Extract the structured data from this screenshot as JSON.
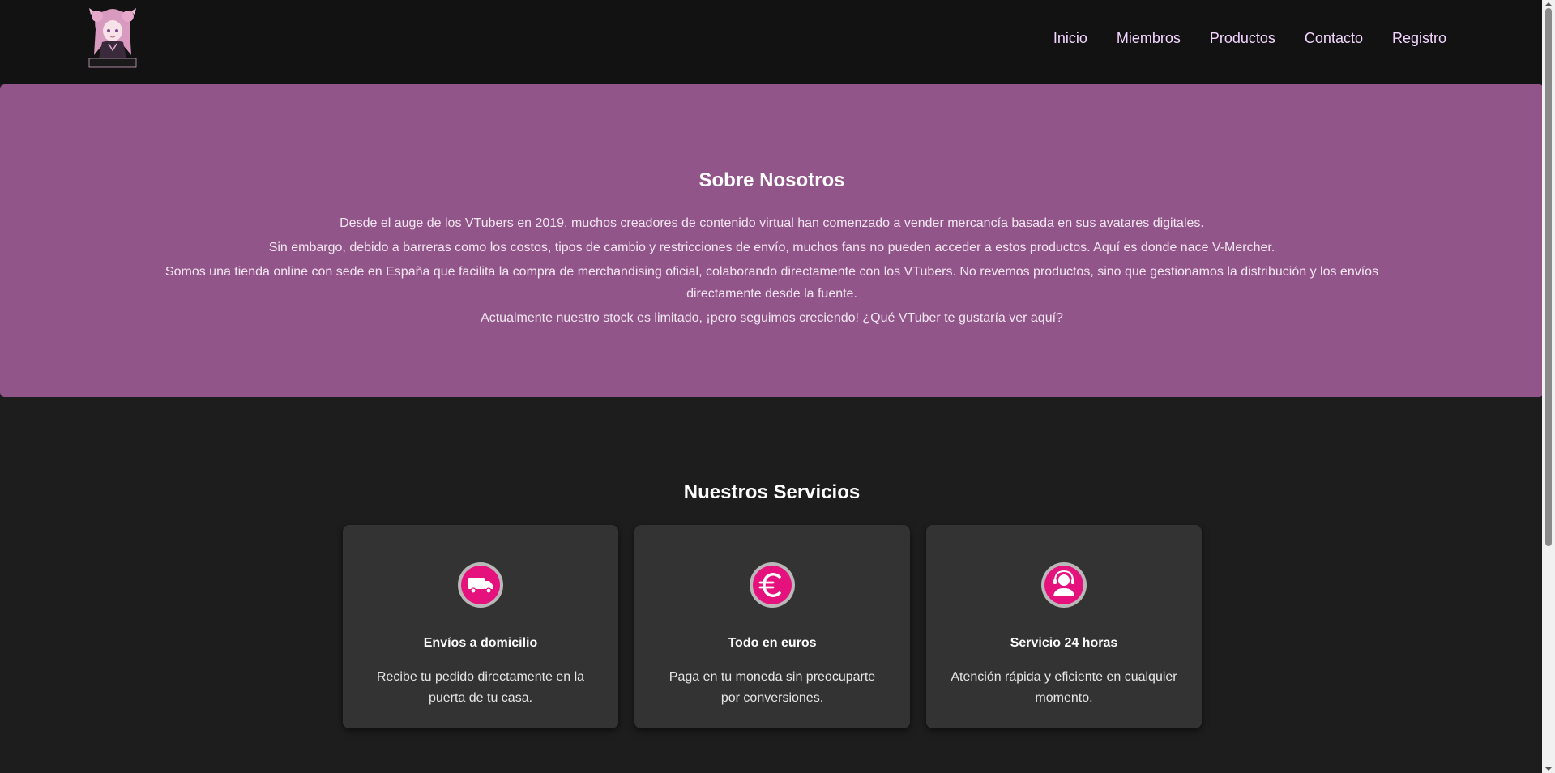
{
  "header": {
    "logo_text": "V-MERCHER",
    "nav": [
      {
        "label": "Inicio"
      },
      {
        "label": "Miembros"
      },
      {
        "label": "Productos"
      },
      {
        "label": "Contacto"
      },
      {
        "label": "Registro"
      }
    ]
  },
  "about": {
    "title": "Sobre Nosotros",
    "paragraphs": [
      "Desde el auge de los VTubers en 2019, muchos creadores de contenido virtual han comenzado a vender mercancía basada en sus avatares digitales.",
      "Sin embargo, debido a barreras como los costos, tipos de cambio y restricciones de envío, muchos fans no pueden acceder a estos productos. Aquí es donde nace V-Mercher.",
      "Somos una tienda online con sede en España que facilita la compra de merchandising oficial, colaborando directamente con los VTubers. No revemos productos, sino que gestionamos la distribución y los envíos directamente desde la fuente.",
      "Actualmente nuestro stock es limitado, ¡pero seguimos creciendo! ¿Qué VTuber te gustaría ver aquí?"
    ]
  },
  "services": {
    "title": "Nuestros Servicios",
    "items": [
      {
        "icon": "truck-icon",
        "title": "Envíos a domicilio",
        "desc": "Recibe tu pedido directamente en la puerta de tu casa."
      },
      {
        "icon": "euro-icon",
        "title": "Todo en euros",
        "desc": "Paga en tu moneda sin preocuparte por conversiones."
      },
      {
        "icon": "support-agent-icon",
        "title": "Servicio 24 horas",
        "desc": "Atención rápida y eficiente en cualquier momento."
      }
    ]
  },
  "colors": {
    "header_bg": "#121212",
    "page_bg": "#1d1d1d",
    "about_bg": "#92558a",
    "card_bg": "#333333",
    "icon_pink": "#e5127d",
    "nav_text": "#f3d6ff"
  }
}
